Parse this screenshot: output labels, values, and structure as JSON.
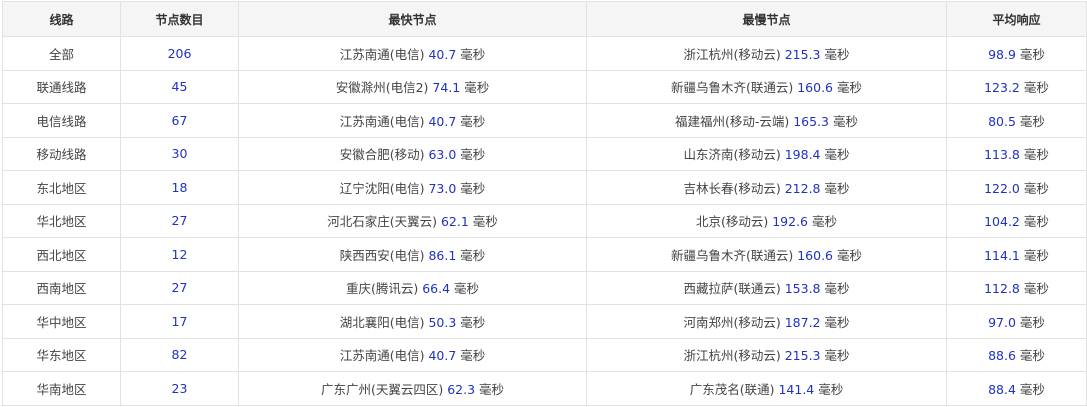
{
  "table": {
    "headers": [
      "线路",
      "节点数目",
      "最快节点",
      "最慢节点",
      "平均响应"
    ],
    "unit": "毫秒",
    "rows": [
      {
        "line": "全部",
        "count": "206",
        "fast_name": "江苏南通(电信)",
        "fast_val": "40.7",
        "slow_name": "浙江杭州(移动云)",
        "slow_val": "215.3",
        "avg": "98.9"
      },
      {
        "line": "联通线路",
        "count": "45",
        "fast_name": "安徽滁州(电信2)",
        "fast_val": "74.1",
        "slow_name": "新疆乌鲁木齐(联通云)",
        "slow_val": "160.6",
        "avg": "123.2"
      },
      {
        "line": "电信线路",
        "count": "67",
        "fast_name": "江苏南通(电信)",
        "fast_val": "40.7",
        "slow_name": "福建福州(移动-云端)",
        "slow_val": "165.3",
        "avg": "80.5"
      },
      {
        "line": "移动线路",
        "count": "30",
        "fast_name": "安徽合肥(移动)",
        "fast_val": "63.0",
        "slow_name": "山东济南(移动云)",
        "slow_val": "198.4",
        "avg": "113.8"
      },
      {
        "line": "东北地区",
        "count": "18",
        "fast_name": "辽宁沈阳(电信)",
        "fast_val": "73.0",
        "slow_name": "吉林长春(移动云)",
        "slow_val": "212.8",
        "avg": "122.0"
      },
      {
        "line": "华北地区",
        "count": "27",
        "fast_name": "河北石家庄(天翼云)",
        "fast_val": "62.1",
        "slow_name": "北京(移动云)",
        "slow_val": "192.6",
        "avg": "104.2"
      },
      {
        "line": "西北地区",
        "count": "12",
        "fast_name": "陕西西安(电信)",
        "fast_val": "86.1",
        "slow_name": "新疆乌鲁木齐(联通云)",
        "slow_val": "160.6",
        "avg": "114.1"
      },
      {
        "line": "西南地区",
        "count": "27",
        "fast_name": "重庆(腾讯云)",
        "fast_val": "66.4",
        "slow_name": "西藏拉萨(联通云)",
        "slow_val": "153.8",
        "avg": "112.8"
      },
      {
        "line": "华中地区",
        "count": "17",
        "fast_name": "湖北襄阳(电信)",
        "fast_val": "50.3",
        "slow_name": "河南郑州(移动云)",
        "slow_val": "187.2",
        "avg": "97.0"
      },
      {
        "line": "华东地区",
        "count": "82",
        "fast_name": "江苏南通(电信)",
        "fast_val": "40.7",
        "slow_name": "浙江杭州(移动云)",
        "slow_val": "215.3",
        "avg": "88.6"
      },
      {
        "line": "华南地区",
        "count": "23",
        "fast_name": "广东广州(天翼云四区)",
        "fast_val": "62.3",
        "slow_name": "广东茂名(联通)",
        "slow_val": "141.4",
        "avg": "88.4"
      }
    ]
  }
}
